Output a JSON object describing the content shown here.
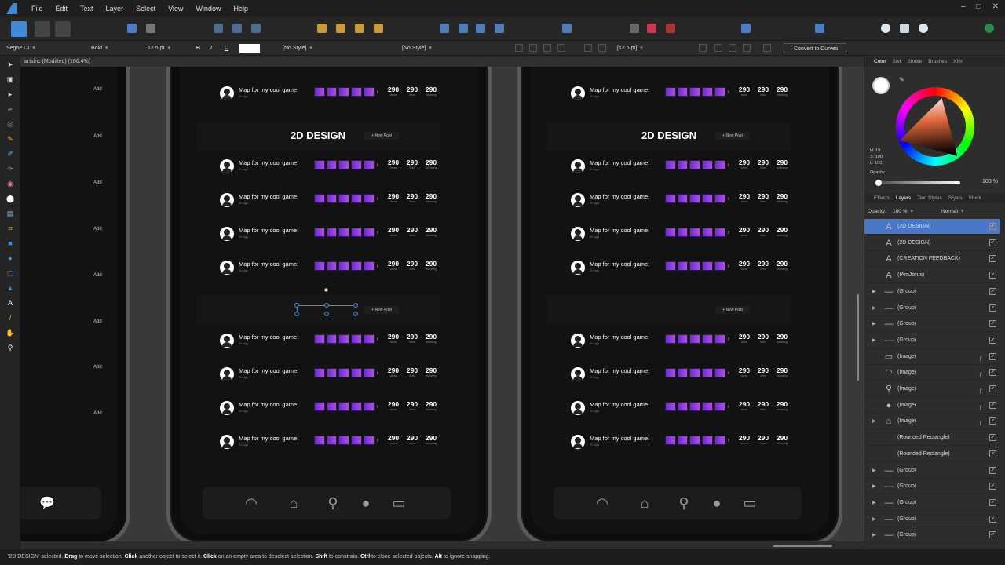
{
  "menu": [
    "File",
    "Edit",
    "Text",
    "Layer",
    "Select",
    "View",
    "Window",
    "Help"
  ],
  "window_controls": [
    "–",
    "□",
    "✕"
  ],
  "context": {
    "font": "Segoe UI",
    "weight": "Bold",
    "size": "12.5 pt",
    "bold": "B",
    "italic": "I",
    "underline": "U",
    "char_style": "[No Style]",
    "para_style": "[No Style]",
    "size2": "[12.5 pt]",
    "convert": "Convert to Curves"
  },
  "doc_tab": "artsinc (Modified) (166.4%)",
  "left_phone": {
    "add_label": "Add"
  },
  "phones": {
    "section_title": "2D DESIGN",
    "new_post": "+ New Post",
    "row_title": "Map for my cool game!",
    "row_sub": "2h ago",
    "stat_value": "290",
    "stat_labels": [
      "views",
      "likes",
      "following"
    ]
  },
  "right_panel": {
    "color_tabs": [
      "Color",
      "Swt",
      "Stroke",
      "Brushes",
      "Xfm"
    ],
    "hsl": [
      "H: 19",
      "S: 100",
      "L: 100"
    ],
    "opacity_label": "Opacity",
    "opacity_value": "100 %",
    "layer_tabs": [
      "Effects",
      "Layers",
      "Text Styles",
      "Styles",
      "Stock"
    ],
    "layers_opacity_label": "Opacity:",
    "layers_opacity_value": "100 %",
    "blend_mode": "Normal",
    "layers": [
      {
        "name": "(2D DESIGN)",
        "icon": "text-icon",
        "selected": true
      },
      {
        "name": "(2D DESIGN)",
        "icon": "text-icon"
      },
      {
        "name": "(CREATION FEEDBACK)",
        "icon": "text-icon"
      },
      {
        "name": "(IAmJorus)",
        "icon": "text-icon"
      },
      {
        "name": "(Group)",
        "icon": "group-icon",
        "expandable": true
      },
      {
        "name": "(Group)",
        "icon": "group-icon",
        "expandable": true
      },
      {
        "name": "(Group)",
        "icon": "group-icon",
        "expandable": true
      },
      {
        "name": "(Group)",
        "icon": "group-icon",
        "expandable": true
      },
      {
        "name": "(Image)",
        "icon": "chat-icon",
        "fx": true
      },
      {
        "name": "(Image)",
        "icon": "rss-icon",
        "fx": true
      },
      {
        "name": "(Image)",
        "icon": "search-icon",
        "fx": true
      },
      {
        "name": "(Image)",
        "icon": "user-icon",
        "fx": true
      },
      {
        "name": "(Image)",
        "icon": "home-icon",
        "fx": true,
        "expandable": true
      },
      {
        "name": "(Rounded Rectangle)",
        "icon": "rect-icon"
      },
      {
        "name": "(Rounded Rectangle)",
        "icon": "rect-icon"
      },
      {
        "name": "(Group)",
        "icon": "group-icon",
        "expandable": true
      },
      {
        "name": "(Group)",
        "icon": "group-icon",
        "expandable": true
      },
      {
        "name": "(Group)",
        "icon": "group-icon",
        "expandable": true
      },
      {
        "name": "(Group)",
        "icon": "group-icon",
        "expandable": true
      },
      {
        "name": "(Group)",
        "icon": "group-icon",
        "expandable": true
      }
    ]
  },
  "status": {
    "selected": "'2D DESIGN' selected.",
    "drag": "Drag",
    "drag_text": "to move selection.",
    "click": "Click",
    "click_text": "another object to select it.",
    "click2": "Click",
    "click2_text": "on an empty area to deselect selection.",
    "shift": "Shift",
    "shift_text": "to constrain.",
    "ctrl": "Ctrl",
    "ctrl_text": "to clone selected objects.",
    "alt": "Alt",
    "alt_text": "to ignore snapping."
  }
}
